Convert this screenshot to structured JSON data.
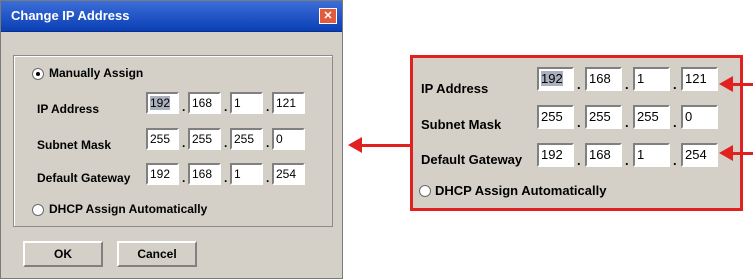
{
  "dialog": {
    "title": "Change IP Address",
    "close_glyph": "✕",
    "manual_label": "Manually Assign",
    "dhcp_label": "DHCP Assign Automatically",
    "ip_label": "IP Address",
    "mask_label": "Subnet Mask",
    "gw_label": "Default Gateway",
    "ip": [
      "192",
      "168",
      "1",
      "121"
    ],
    "mask": [
      "255",
      "255",
      "255",
      "0"
    ],
    "gw": [
      "192",
      "168",
      "1",
      "254"
    ],
    "ok_label": "OK",
    "cancel_label": "Cancel",
    "separator": "."
  },
  "zoom": {
    "ip_label": "IP Address",
    "mask_label": "Subnet Mask",
    "gw_label": "Default Gateway",
    "dhcp_label": "DHCP Assign Automatically",
    "ip": [
      "192",
      "168",
      "1",
      "121"
    ],
    "mask": [
      "255",
      "255",
      "255",
      "0"
    ],
    "gw": [
      "192",
      "168",
      "1",
      "254"
    ],
    "separator": "."
  },
  "colors": {
    "accent": "#e0211f",
    "dialog_bg": "#d4d0c8",
    "title_blue": "#0a3fb5"
  }
}
